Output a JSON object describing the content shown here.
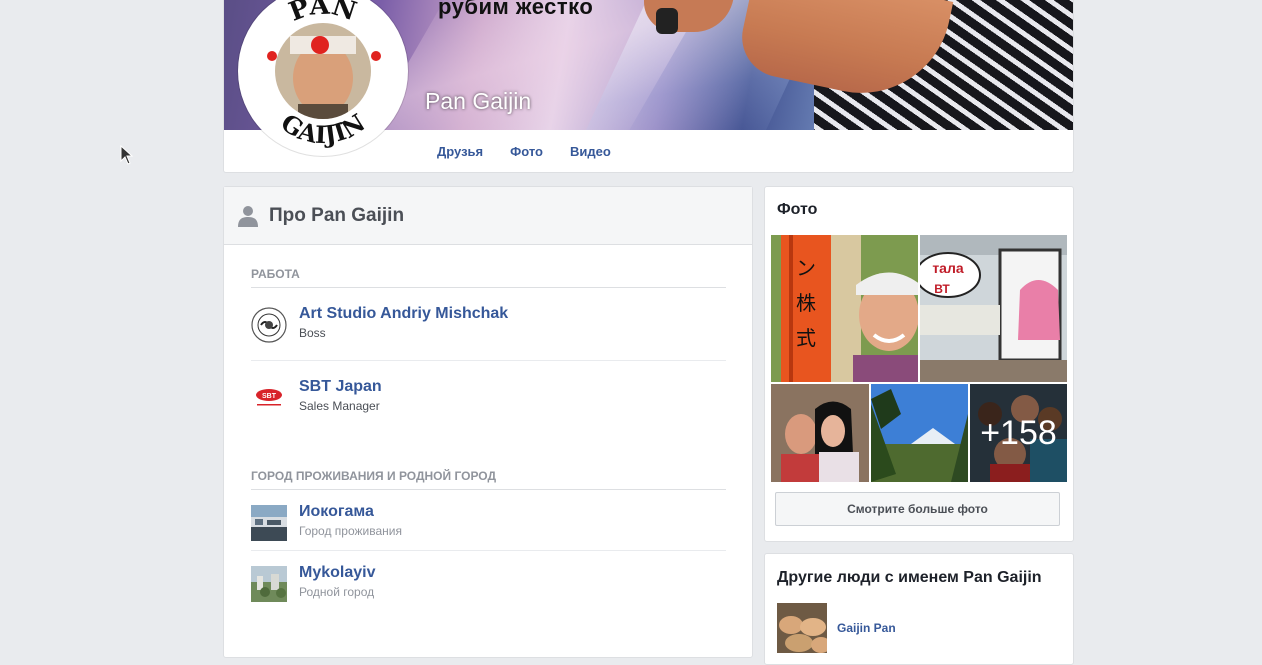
{
  "profile": {
    "cover_slogan": "рубим жестко",
    "name": "Pan Gaijin",
    "avatar_text_top": "PAN",
    "avatar_text_bottom": "GAIJIN",
    "nav": [
      {
        "label": "Друзья"
      },
      {
        "label": "Фото"
      },
      {
        "label": "Видео"
      }
    ]
  },
  "about": {
    "title": "Про Pan Gaijin",
    "work_section": "РАБОТА",
    "work": [
      {
        "title": "Art Studio Andriy Mishchak",
        "subtitle": "Boss"
      },
      {
        "title": "SBT Japan",
        "subtitle": "Sales Manager",
        "logo_text": "SBT"
      }
    ],
    "places_section": "ГОРОД ПРОЖИВАНИЯ И РОДНОЙ ГОРОД",
    "places": [
      {
        "title": "Иокогама",
        "subtitle": "Город проживания"
      },
      {
        "title": "Mykolayiv",
        "subtitle": "Родной город"
      }
    ]
  },
  "photos": {
    "title": "Фото",
    "more_count": "+158",
    "see_more_label": "Смотрите больше фото"
  },
  "others": {
    "title": "Другие люди с именем Pan Gaijin",
    "people": [
      {
        "name": "Gaijin Pan"
      }
    ]
  }
}
